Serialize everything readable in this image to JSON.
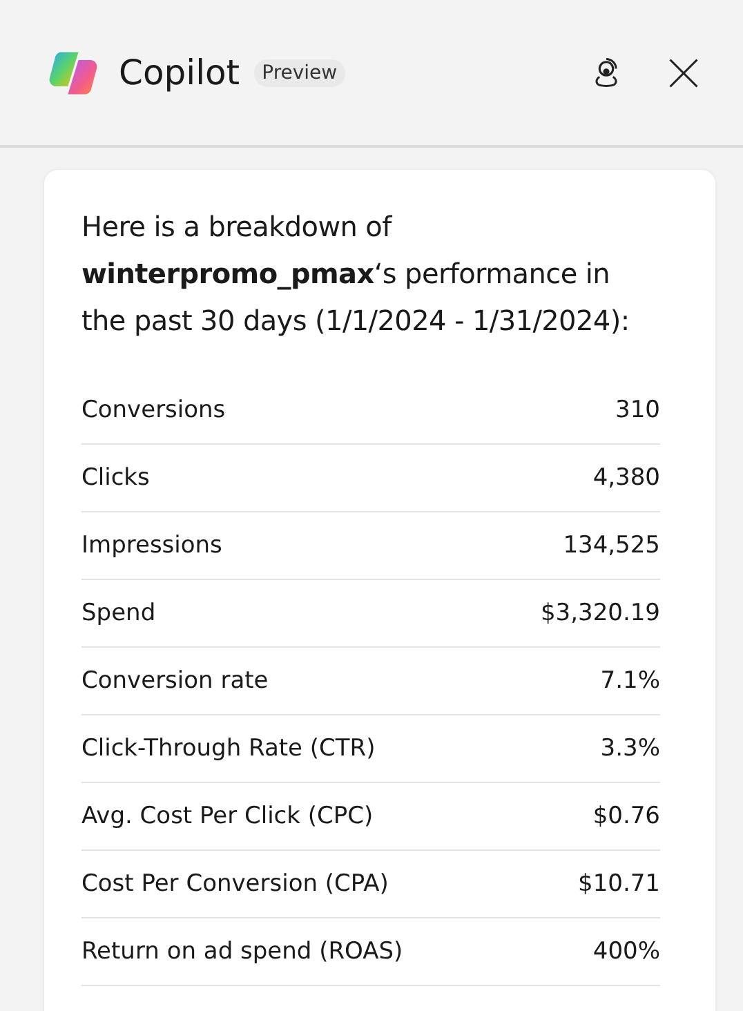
{
  "header": {
    "title": "Copilot",
    "badge": "Preview"
  },
  "message": {
    "intro": "Here is a breakdown of **winterpromo_pmax**‘s performance in the past 30 days (1/1/2024 - 1/31/2024):",
    "rows": [
      {
        "label": "Conversions",
        "value": "310"
      },
      {
        "label": "Clicks",
        "value": "4,380"
      },
      {
        "label": "Impressions",
        "value": "134,525"
      },
      {
        "label": "Spend",
        "value": "$3,320.19"
      },
      {
        "label": "Conversion rate",
        "value": "7.1%"
      },
      {
        "label": "Click-Through Rate (CTR)",
        "value": "3.3%"
      },
      {
        "label": "Avg. Cost Per Click (CPC)",
        "value": "$0.76"
      },
      {
        "label": "Cost Per Conversion (CPA)",
        "value": "$10.71"
      },
      {
        "label": "Return on ad spend (ROAS)",
        "value": "400%"
      }
    ]
  }
}
